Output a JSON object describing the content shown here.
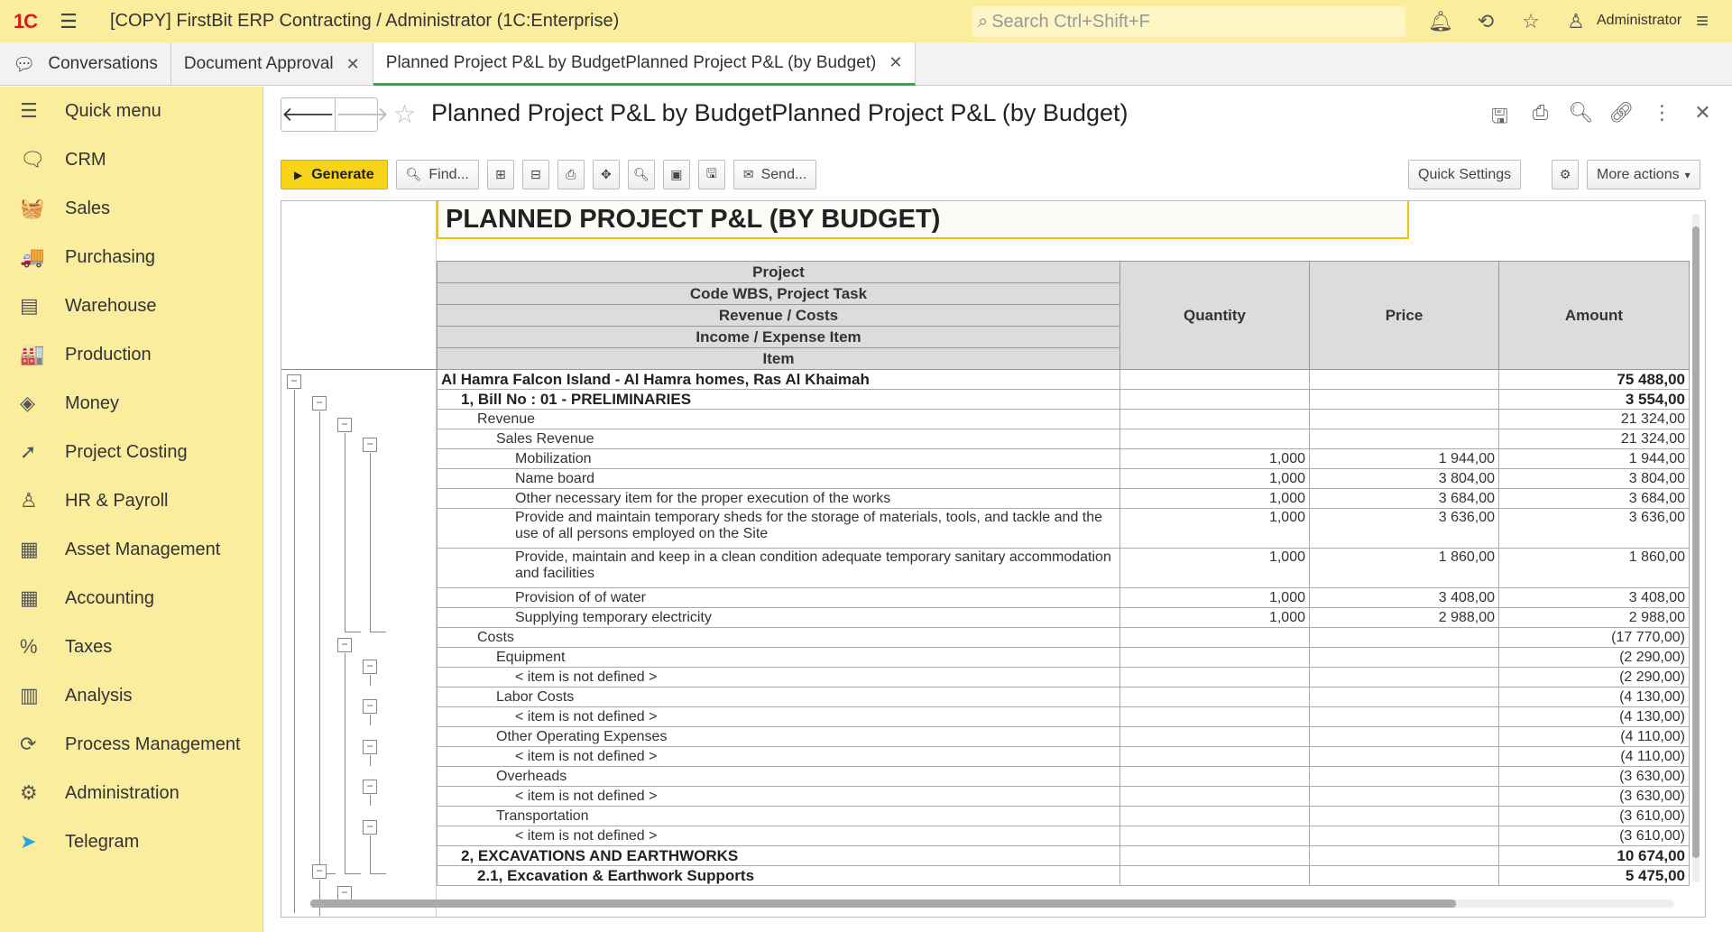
{
  "app": {
    "logo": "1С",
    "title": "[COPY] FirstBit ERP Contracting / Administrator  (1C:Enterprise)",
    "search_placeholder": "Search Ctrl+Shift+F",
    "user": "Administrator"
  },
  "tabs": [
    {
      "label": "Conversations"
    },
    {
      "label": "Document Approval"
    },
    {
      "label": "Planned Project P&L by BudgetPlanned Project P&L (by Budget)"
    }
  ],
  "sidebar": {
    "items": [
      {
        "label": "Quick menu",
        "icon": "☰"
      },
      {
        "label": "CRM",
        "icon": "🗨"
      },
      {
        "label": "Sales",
        "icon": "🧺"
      },
      {
        "label": "Purchasing",
        "icon": "🚚"
      },
      {
        "label": "Warehouse",
        "icon": "▤"
      },
      {
        "label": "Production",
        "icon": "🏭"
      },
      {
        "label": "Money",
        "icon": "◈"
      },
      {
        "label": "Project Costing",
        "icon": "➚"
      },
      {
        "label": "HR & Payroll",
        "icon": "♙"
      },
      {
        "label": "Asset Management",
        "icon": "▦"
      },
      {
        "label": "Accounting",
        "icon": "▦"
      },
      {
        "label": "Taxes",
        "icon": "%"
      },
      {
        "label": "Analysis",
        "icon": "▥"
      },
      {
        "label": "Process Management",
        "icon": "⟳"
      },
      {
        "label": "Administration",
        "icon": "⚙"
      },
      {
        "label": "Telegram",
        "icon": "➤"
      }
    ]
  },
  "document": {
    "title": "Planned Project P&L by BudgetPlanned Project P&L (by Budget)"
  },
  "toolbar": {
    "generate": "Generate",
    "find": "Find...",
    "send": "Send...",
    "quick_settings": "Quick Settings",
    "more_actions": "More actions"
  },
  "report": {
    "title": "PLANNED PROJECT P&L (BY BUDGET)",
    "headers": {
      "h1": "Project",
      "h2": "Code WBS, Project Task",
      "h3": "Revenue / Costs",
      "h4": "Income / Expense Item",
      "h5": "Item",
      "quantity": "Quantity",
      "price": "Price",
      "amount": "Amount"
    },
    "rows": [
      {
        "name": "Al Hamra Falcon Island - Al Hamra homes, Ras Al Khaimah",
        "qty": "",
        "price": "",
        "amount": "75 488,00",
        "level": 0,
        "bold": true
      },
      {
        "name": "1, Bill No : 01 - PRELIMINARIES",
        "qty": "",
        "price": "",
        "amount": "3 554,00",
        "level": 1,
        "bold": true
      },
      {
        "name": "Revenue",
        "qty": "",
        "price": "",
        "amount": "21 324,00",
        "level": 2
      },
      {
        "name": "Sales Revenue",
        "qty": "",
        "price": "",
        "amount": "21 324,00",
        "level": 3
      },
      {
        "name": "Mobilization",
        "qty": "1,000",
        "price": "1 944,00",
        "amount": "1 944,00",
        "level": 4
      },
      {
        "name": "Name board",
        "qty": "1,000",
        "price": "3 804,00",
        "amount": "3 804,00",
        "level": 4
      },
      {
        "name": "Other necessary item for the proper execution of the works",
        "qty": "1,000",
        "price": "3 684,00",
        "amount": "3 684,00",
        "level": 4
      },
      {
        "name": "Provide and maintain temporary sheds for the storage of materials, tools, and tackle and the use of all persons employed on the Site",
        "qty": "1,000",
        "price": "3 636,00",
        "amount": "3 636,00",
        "level": 4,
        "tall": true
      },
      {
        "name": "Provide, maintain and keep in a clean condition adequate temporary sanitary accommodation and facilities",
        "qty": "1,000",
        "price": "1 860,00",
        "amount": "1 860,00",
        "level": 4,
        "tall": true
      },
      {
        "name": "Provision of of water",
        "qty": "1,000",
        "price": "3 408,00",
        "amount": "3 408,00",
        "level": 4
      },
      {
        "name": "Supplying temporary electricity",
        "qty": "1,000",
        "price": "2 988,00",
        "amount": "2 988,00",
        "level": 4
      },
      {
        "name": "Costs",
        "qty": "",
        "price": "",
        "amount": "(17 770,00)",
        "level": 2
      },
      {
        "name": "Equipment",
        "qty": "",
        "price": "",
        "amount": "(2 290,00)",
        "level": 3
      },
      {
        "name": "< item is not defined >",
        "qty": "",
        "price": "",
        "amount": "(2 290,00)",
        "level": 4
      },
      {
        "name": "Labor Costs",
        "qty": "",
        "price": "",
        "amount": "(4 130,00)",
        "level": 3
      },
      {
        "name": "< item is not defined >",
        "qty": "",
        "price": "",
        "amount": "(4 130,00)",
        "level": 4
      },
      {
        "name": "Other Operating Expenses",
        "qty": "",
        "price": "",
        "amount": "(4 110,00)",
        "level": 3
      },
      {
        "name": "< item is not defined >",
        "qty": "",
        "price": "",
        "amount": "(4 110,00)",
        "level": 4
      },
      {
        "name": "Overheads",
        "qty": "",
        "price": "",
        "amount": "(3 630,00)",
        "level": 3
      },
      {
        "name": "< item is not defined >",
        "qty": "",
        "price": "",
        "amount": "(3 630,00)",
        "level": 4
      },
      {
        "name": "Transportation",
        "qty": "",
        "price": "",
        "amount": "(3 610,00)",
        "level": 3
      },
      {
        "name": "< item is not defined >",
        "qty": "",
        "price": "",
        "amount": "(3 610,00)",
        "level": 4
      },
      {
        "name": "2, EXCAVATIONS AND EARTHWORKS",
        "qty": "",
        "price": "",
        "amount": "10 674,00",
        "level": 1,
        "bold": true
      },
      {
        "name": "2.1, Excavation & Earthwork Supports",
        "qty": "",
        "price": "",
        "amount": "5 475,00",
        "level": 2,
        "bold": true
      }
    ]
  }
}
